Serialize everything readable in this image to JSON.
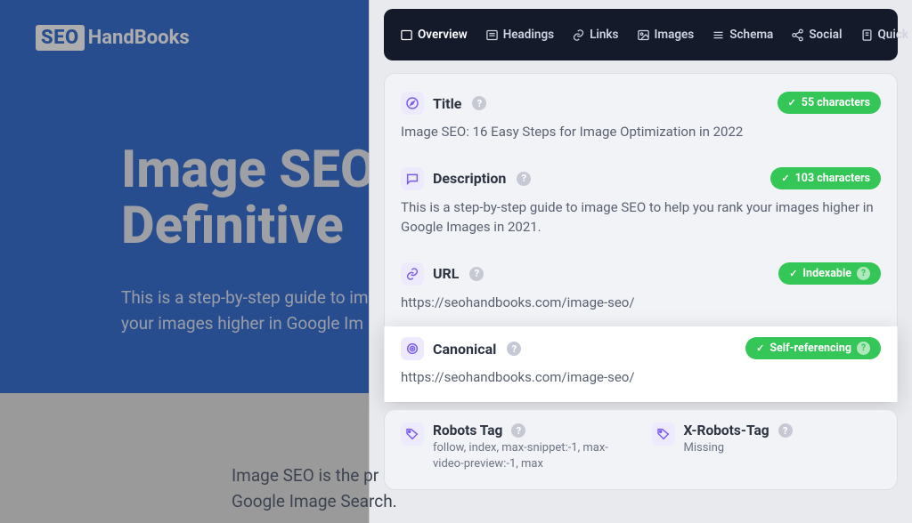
{
  "logo": {
    "box": "SEO",
    "rest": "HandBooks"
  },
  "hero": {
    "title": "Image SEO\nDefinitive",
    "subtitle": "This is a step-by-step guide to im\nyour images higher in Google Im"
  },
  "body_text": "Image SEO is the pr\nGoogle Image Search.",
  "tabs": {
    "overview": "Overview",
    "headings": "Headings",
    "links": "Links",
    "images": "Images",
    "schema": "Schema",
    "social": "Social",
    "quick_links": "Quick Links"
  },
  "sections": {
    "title": {
      "label": "Title",
      "value": "Image SEO: 16 Easy Steps for Image Optimization in 2022",
      "badge": "55 characters"
    },
    "description": {
      "label": "Description",
      "value": "This is a step-by-step guide to image SEO to help you rank your images higher in Google Images in 2021.",
      "badge": "103 characters"
    },
    "url": {
      "label": "URL",
      "value": "https://seohandbooks.com/image-seo/",
      "badge": "Indexable"
    },
    "canonical": {
      "label": "Canonical",
      "value": "https://seohandbooks.com/image-seo/",
      "badge": "Self-referencing"
    }
  },
  "robots": {
    "tag_label": "Robots Tag",
    "tag_value": "follow, index, max-snippet:-1, max-video-preview:-1, max",
    "xrobots_label": "X-Robots-Tag",
    "xrobots_value": "Missing"
  }
}
